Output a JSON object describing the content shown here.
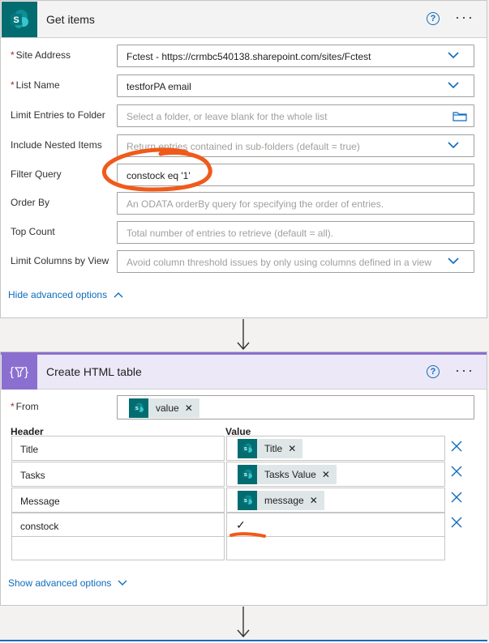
{
  "get_items": {
    "title": "Get items",
    "help": "?",
    "more": "···",
    "fields": [
      {
        "label": "Site Address",
        "required": true,
        "value": "Fctest - https://crmbc540138.sharepoint.com/sites/Fctest",
        "placeholder": "",
        "control": "dropdown"
      },
      {
        "label": "List Name",
        "required": true,
        "value": "testforPA email",
        "placeholder": "",
        "control": "dropdown"
      },
      {
        "label": "Limit Entries to Folder",
        "required": false,
        "value": "",
        "placeholder": "Select a folder, or leave blank for the whole list",
        "control": "folder"
      },
      {
        "label": "Include Nested Items",
        "required": false,
        "value": "",
        "placeholder": "Return entries contained in sub-folders (default = true)",
        "control": "dropdown"
      },
      {
        "label": "Filter Query",
        "required": false,
        "value": "constock eq '1'",
        "placeholder": "",
        "control": "text"
      },
      {
        "label": "Order By",
        "required": false,
        "value": "",
        "placeholder": "An ODATA orderBy query for specifying the order of entries.",
        "control": "text"
      },
      {
        "label": "Top Count",
        "required": false,
        "value": "",
        "placeholder": "Total number of entries to retrieve (default = all).",
        "control": "text"
      },
      {
        "label": "Limit Columns by View",
        "required": false,
        "value": "",
        "placeholder": "Avoid column threshold issues by only using columns defined in a view",
        "control": "dropdown"
      }
    ],
    "hide_advanced": "Hide advanced options"
  },
  "html_table": {
    "title": "Create HTML table",
    "help": "?",
    "more": "···",
    "from_label": "From",
    "from_token": "value",
    "header_col": "Header",
    "value_col": "Value",
    "rows": [
      {
        "header": "Title",
        "token": "Title",
        "plain": ""
      },
      {
        "header": "Tasks",
        "token": "Tasks Value",
        "plain": ""
      },
      {
        "header": "Message",
        "token": "message",
        "plain": ""
      },
      {
        "header": "constock",
        "token": "",
        "plain": "✓"
      }
    ],
    "show_advanced": "Show advanced options"
  },
  "icons": {
    "sharepoint": "sharepoint-icon",
    "data_operation": "data-operation-icon",
    "remove": "close-icon",
    "folder": "folder-icon",
    "chevron": "chevron-down-icon"
  },
  "colors": {
    "sharepoint": "#036c70",
    "data_operation": "#8b6fd0",
    "link": "#0f6cbd",
    "annotation": "#f05a1a"
  }
}
